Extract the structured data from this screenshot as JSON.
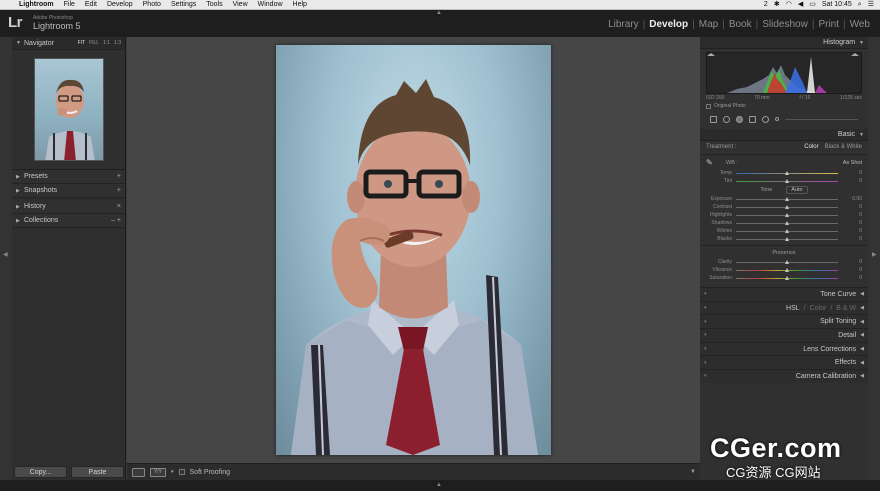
{
  "menubar": {
    "app": "Lightroom",
    "items": [
      "File",
      "Edit",
      "Develop",
      "Photo",
      "Settings",
      "Tools",
      "View",
      "Window",
      "Help"
    ],
    "status_2": "2",
    "clock": "Sat 10:45"
  },
  "identity": {
    "logo": "Lr",
    "vendor": "Adobe Photoshop",
    "product": "Lightroom 5"
  },
  "modules": [
    "Library",
    "Develop",
    "Map",
    "Book",
    "Slideshow",
    "Print",
    "Web"
  ],
  "active_module": "Develop",
  "left_panel": {
    "navigator_title": "Navigator",
    "zoom_options": [
      "FIT",
      "FILL",
      "1:1",
      "1:3"
    ],
    "sections": [
      {
        "label": "Presets",
        "action": "+"
      },
      {
        "label": "Snapshots",
        "action": "+"
      },
      {
        "label": "History",
        "action": "×"
      },
      {
        "label": "Collections",
        "action": "– +"
      }
    ],
    "copy_label": "Copy...",
    "paste_label": "Paste"
  },
  "toolbar": {
    "view_label": "Y|Y",
    "soft_proofing": "Soft Proofing"
  },
  "right_panel": {
    "histogram_title": "Histogram",
    "histo_info": [
      "ISO 200",
      "70 mm",
      "f / 16",
      "1/125 sec"
    ],
    "original_photo": "Original Photo",
    "basic_title": "Basic",
    "treatment_label": "Treatment :",
    "treatment_options": [
      "Color",
      "Black & White"
    ],
    "wb_label": "WB :",
    "wb_value": "As Shot",
    "wb_sliders": [
      {
        "label": "Temp",
        "value": "0",
        "pos": 0.5
      },
      {
        "label": "Tint",
        "value": "0",
        "pos": 0.5
      }
    ],
    "tone_label": "Tone",
    "auto_label": "Auto",
    "tone_sliders": [
      {
        "label": "Exposure",
        "value": "0.00",
        "pos": 0.5
      },
      {
        "label": "Contrast",
        "value": "0",
        "pos": 0.5
      },
      {
        "label": "Highlights",
        "value": "0",
        "pos": 0.5
      },
      {
        "label": "Shadows",
        "value": "0",
        "pos": 0.5
      },
      {
        "label": "Whites",
        "value": "0",
        "pos": 0.5
      },
      {
        "label": "Blacks",
        "value": "0",
        "pos": 0.5
      }
    ],
    "presence_label": "Presence",
    "presence_sliders": [
      {
        "label": "Clarity",
        "value": "0",
        "pos": 0.5
      },
      {
        "label": "Vibrance",
        "value": "0",
        "pos": 0.5
      },
      {
        "label": "Saturation",
        "value": "0",
        "pos": 0.5
      }
    ],
    "collapsed_panels": [
      "Tone Curve",
      "HSL",
      "Split Toning",
      "Detail",
      "Lens Corrections",
      "Effects",
      "Camera Calibration"
    ],
    "hsl_extra": [
      "Color",
      "B & W"
    ]
  },
  "watermark": {
    "main": "CGer.com",
    "sub": "CG资源 CG网站"
  },
  "colors": {
    "accent": "#ededed",
    "panel": "#303030",
    "tie": "#8c1f2d"
  }
}
